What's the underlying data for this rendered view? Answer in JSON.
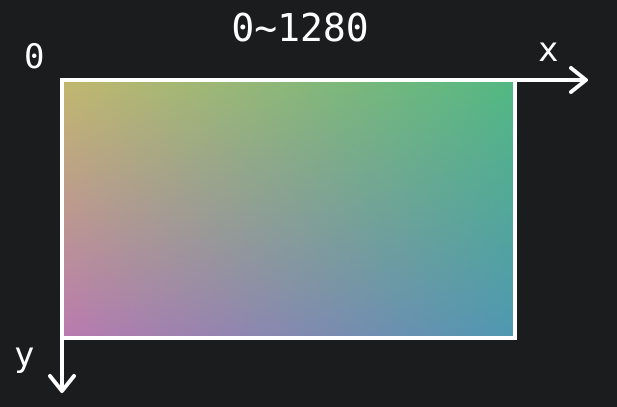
{
  "labels": {
    "range": "0~1280",
    "origin": "0",
    "x_axis": "x",
    "y_axis": "y"
  },
  "colors": {
    "background": "#1b1c1e",
    "line": "#ffffff",
    "gradient_top_left": "#c2b86e",
    "gradient_top_right": "#52b882",
    "gradient_bottom_left": "#ba7ab0",
    "gradient_bottom_right": "#4f98b2"
  }
}
